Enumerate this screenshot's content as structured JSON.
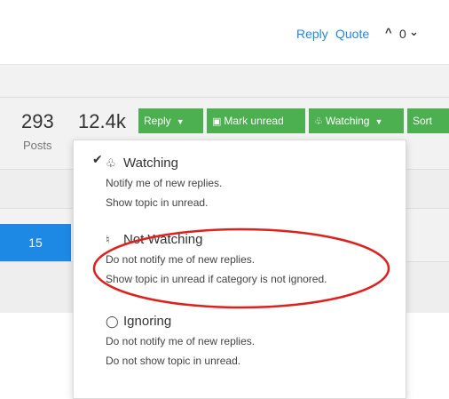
{
  "post_actions": {
    "reply_label": "Reply",
    "quote_label": "Quote",
    "vote_up_icon": "chevron-up-icon",
    "vote_count": "0",
    "vote_down_icon": "chevron-down-icon"
  },
  "topic_stats": {
    "posts_count": "293",
    "posts_label": "Posts",
    "views_count": "12.4k"
  },
  "toolbar": {
    "reply_label": "Reply",
    "mark_unread_label": "Mark unread",
    "watching_label": "Watching",
    "sort_label": "Sort"
  },
  "badge": {
    "value": "15"
  },
  "watch_menu": {
    "selected": "watching",
    "options": [
      {
        "id": "watching",
        "icon": "bell-icon",
        "title": "Watching",
        "lines": [
          "Notify me of new replies.",
          "Show topic in unread."
        ]
      },
      {
        "id": "not-watching",
        "icon": "bell-slash-icon",
        "title": "Not Watching",
        "lines": [
          "Do not notify me of new replies.",
          "Show topic in unread if category is not ignored."
        ]
      },
      {
        "id": "ignoring",
        "icon": "eye-slash-icon",
        "title": "Ignoring",
        "lines": [
          "Do not notify me of new replies.",
          "Do not show topic in unread."
        ]
      }
    ]
  },
  "colors": {
    "accent_green": "#4caf50",
    "link_blue": "#1e88e5",
    "annotation_red": "#e0201b"
  }
}
